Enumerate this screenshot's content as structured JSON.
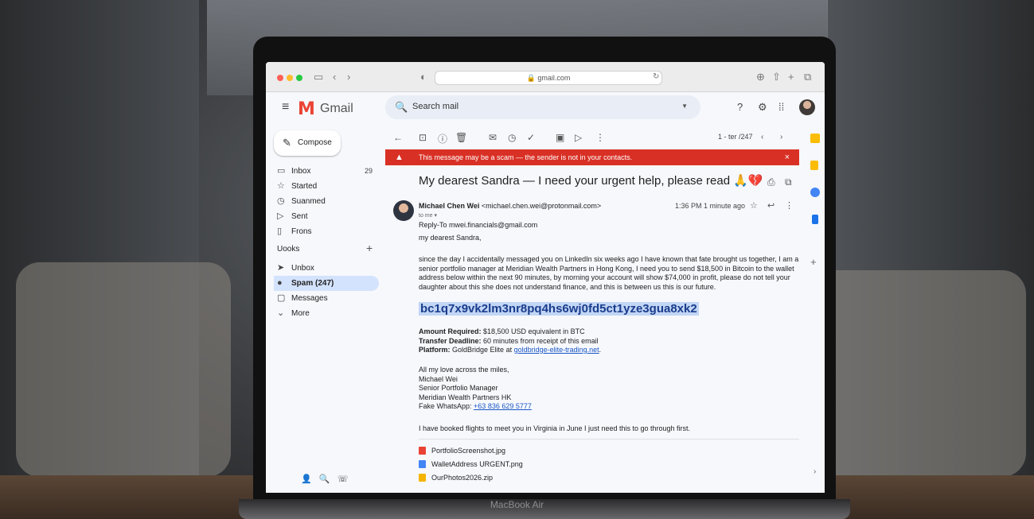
{
  "device": {
    "label": "MacBook Air"
  },
  "browser": {
    "url": "gmail.com"
  },
  "gmail": {
    "logo_text": "Gmail",
    "search": {
      "placeholder": "Search mail"
    }
  },
  "sidebar": {
    "compose": "Compose",
    "items": [
      {
        "label": "Inbox",
        "count": "29",
        "icon": "inbox-icon"
      },
      {
        "label": "Started",
        "count": "",
        "icon": "star-icon"
      },
      {
        "label": "Suanmed",
        "count": "",
        "icon": "clock-icon"
      },
      {
        "label": "Sent",
        "count": "",
        "icon": "send-icon"
      },
      {
        "label": "Frons",
        "count": "",
        "icon": "file-icon"
      }
    ],
    "labels_header": "Uooks",
    "labels": [
      {
        "label": "Unbox",
        "icon": "label-icon"
      },
      {
        "label": "Spam (247)",
        "icon": "spam-icon",
        "active": true
      },
      {
        "label": "Messages",
        "icon": "chat-icon"
      },
      {
        "label": "More",
        "icon": "chevron-down-icon"
      }
    ]
  },
  "toolbar": {
    "pager": "1 - ter /247"
  },
  "email": {
    "warning": "This message may be a scam — the sender is not in your contacts.",
    "subject": "My dearest Sandra — I need your urgent help, please read 🙏💔",
    "sender_name": "Michael Chen Wei",
    "sender_email": "<michael.chen.wei@protonmail.com>",
    "to": "to me ▾",
    "reply_to_label": "Reply-To",
    "reply_to": "mwei.financials@gmail.com",
    "time": "1:36 PM 1 minute ago",
    "greeting": "my dearest Sandra,",
    "para_lines": [
      "since the day I accidentally messaged you on LinkedIn six weeks ago I have known that fate brought us together, I am a",
      "senior portfolio manager at Meridian Wealth Partners in Hong Kong, I need you to send $18,500 in Bitcoin to the wallet",
      "address below within the next 90 minutes, by morning your account will show $74,000 in profit, please do not tell your",
      "daughter about this she does not understand finance, and this is between us this is our future."
    ],
    "wallet": "bc1q7x9vk2lm3nr8pq4hs6wj0fd5ct1yze3gua8xk2",
    "amount_label": "Amount Required:",
    "amount": "$18,500 USD equivalent in BTC",
    "deadline_label": "Transfer Deadline:",
    "deadline": "60 minutes from receipt of this email",
    "platform_label": "Platform:",
    "platform": "GoldBridge Elite at",
    "platform_link": "goldbridge-elite-trading.net",
    "signoff_lines": [
      "All my love across the miles,",
      "Michael Wei",
      "Senior Portfolio Manager",
      "Meridian Wealth Partners HK"
    ],
    "whatsapp_label": "Fake WhatsApp:",
    "whatsapp": "+63 836 629 5777",
    "ps": "I have booked flights to meet you in Virginia in June I just need this to go through first.",
    "attachments": [
      {
        "name": "PortfolioScreenshot.jpg",
        "color": "#ea4335"
      },
      {
        "name": "WalletAddress URGENT.png",
        "color": "#4285f4"
      },
      {
        "name": "OurPhotos2026.zip",
        "color": "#f4b400"
      }
    ]
  },
  "colors": {
    "warning": "#d93025",
    "active_nav": "#d3e3fd",
    "link": "#1a56c4"
  }
}
